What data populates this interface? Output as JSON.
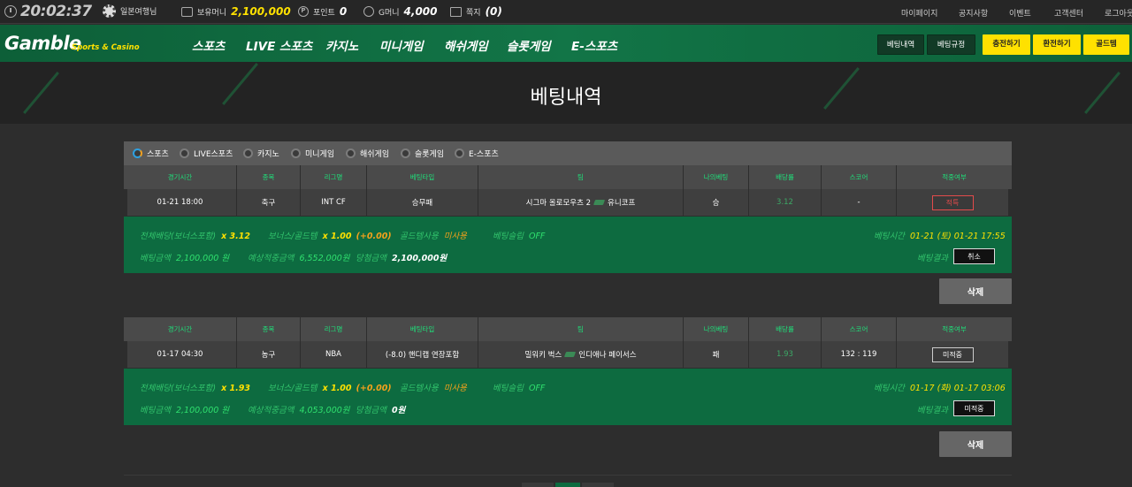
{
  "topbar": {
    "time": "20:02:37",
    "nickname": "일본여행님",
    "cash_label": "보유머니",
    "cash_value": "2,100,000",
    "point_label": "포인트",
    "point_value": "0",
    "gmoney_label": "G머니",
    "gmoney_value": "4,000",
    "memo_label": "쪽지",
    "memo_value": "(0)",
    "links": [
      "마이페이지",
      "공지사항",
      "이벤트",
      "고객센터",
      "로그아웃"
    ]
  },
  "header": {
    "logo": "Gamble",
    "logo_sub": "Sports & Casino",
    "nav": [
      "스포츠",
      "LIVE 스포츠",
      "카지노",
      "미니게임",
      "해쉬게임",
      "슬롯게임",
      "E-스포츠"
    ],
    "btn_history": "베팅내역",
    "btn_rules": "베팅규정",
    "btn_deposit": "충전하기",
    "btn_withdraw": "환전하기",
    "btn_gold": "골드템"
  },
  "page_title": "베팅내역",
  "tabs": [
    "스포츠",
    "LIVE스포츠",
    "카지노",
    "미니게임",
    "해쉬게임",
    "슬롯게임",
    "E-스포츠"
  ],
  "columns": [
    "경기시간",
    "종목",
    "리그명",
    "베팅타입",
    "팀",
    "나의베팅",
    "배당률",
    "스코어",
    "적중여부"
  ],
  "bets": [
    {
      "time": "01-21 18:00",
      "sport": "축구",
      "league": "INT CF",
      "bet_type": "승무패",
      "home": "시그마 올로모우츠 2",
      "away": "유니코프",
      "my_bet": "승",
      "odds": "3.12",
      "score": "-",
      "result": "적특",
      "total_odds_label": "전체배당(보너스포함)",
      "total_odds": "x 3.12",
      "bonus_label": "보너스/골드템",
      "bonus_value": "x 1.00",
      "bonus_extra": "(+0.00)",
      "gold_label": "골드템사용",
      "gold_value": "미사용",
      "wallet_label": "베팅슬립",
      "wallet_value": "OFF",
      "bet_time_label": "베팅시간",
      "bet_time_value": "01-21 (토) 01-21 17:55",
      "amount_label": "베팅금액",
      "amount_value": "2,100,000 원",
      "expected_label": "예상적중금액",
      "expected_value": "6,552,000원",
      "win_label": "당첨금액",
      "win_value": "2,100,000원",
      "result_label": "베팅결과",
      "result_btn": "취소",
      "delete": "삭제"
    },
    {
      "time": "01-17 04:30",
      "sport": "농구",
      "league": "NBA",
      "bet_type": "(-8.0) 핸디캡 연장포함",
      "home": "밀워키 벅스",
      "away": "인디애나 페이서스",
      "my_bet": "패",
      "odds": "1.93",
      "score": "132 : 119",
      "result": "미적중",
      "total_odds_label": "전체배당(보너스포함)",
      "total_odds": "x 1.93",
      "bonus_label": "보너스/골드템",
      "bonus_value": "x 1.00",
      "bonus_extra": "(+0.00)",
      "gold_label": "골드템사용",
      "gold_value": "미사용",
      "wallet_label": "베팅슬립",
      "wallet_value": "OFF",
      "bet_time_label": "베팅시간",
      "bet_time_value": "01-17 (화) 01-17 03:06",
      "amount_label": "베팅금액",
      "amount_value": "2,100,000 원",
      "expected_label": "예상적중금액",
      "expected_value": "4,053,000원",
      "win_label": "당첨금액",
      "win_value": "0원",
      "result_label": "베팅결과",
      "result_btn": "미적중",
      "delete": "삭제"
    }
  ],
  "colors": {
    "brand_green": "#0d6b40",
    "accent_yellow": "#ffe100",
    "header_text_green": "#1fe07a",
    "result_red": "#e24b4b"
  }
}
